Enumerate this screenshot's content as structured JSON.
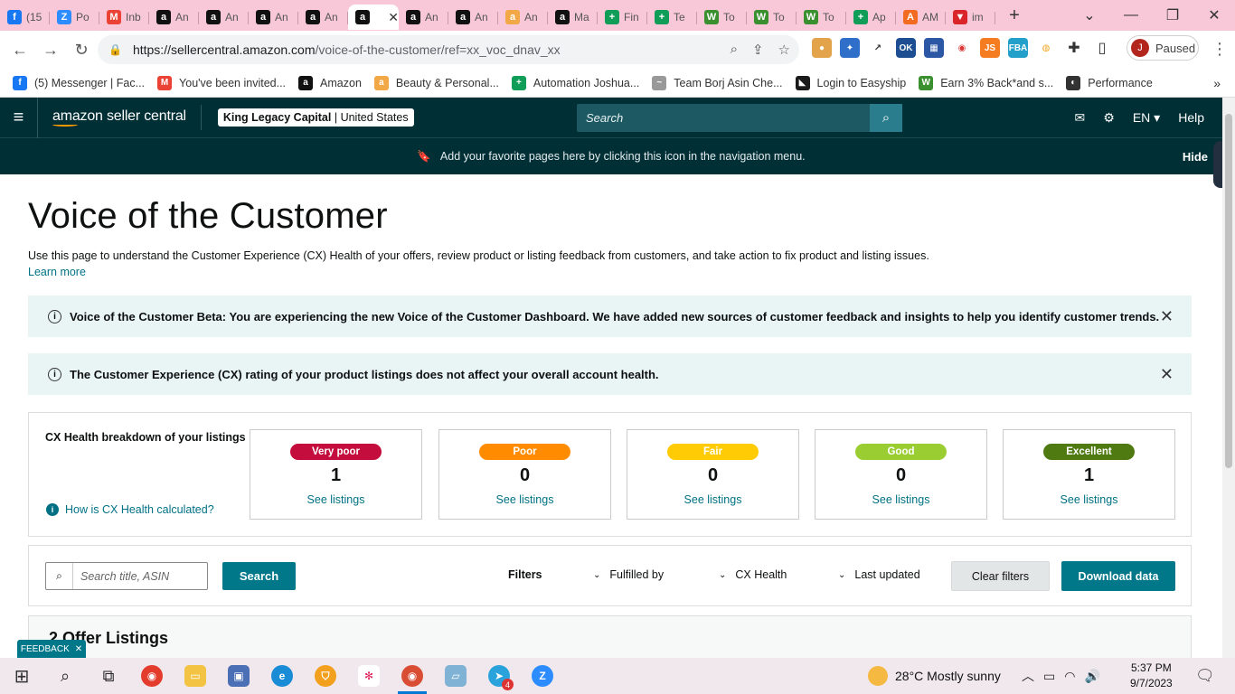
{
  "browser": {
    "tabs": [
      {
        "label": "(15",
        "icon": "facebook-icon",
        "color": "#1877f2",
        "glyph": "f"
      },
      {
        "label": "Po",
        "icon": "zoom-icon",
        "color": "#2d8cff",
        "glyph": "Z"
      },
      {
        "label": "Inb",
        "icon": "gmail-icon",
        "color": "#ea4335",
        "glyph": "M"
      },
      {
        "label": "An",
        "icon": "amazon-icon",
        "color": "#111",
        "glyph": "a"
      },
      {
        "label": "An",
        "icon": "amazon-icon",
        "color": "#111",
        "glyph": "a"
      },
      {
        "label": "An",
        "icon": "amazon-icon",
        "color": "#111",
        "glyph": "a"
      },
      {
        "label": "An",
        "icon": "amazon-icon",
        "color": "#111",
        "glyph": "a"
      },
      {
        "label": "",
        "icon": "amazon-icon",
        "color": "#111",
        "glyph": "a",
        "active": true
      },
      {
        "label": "An",
        "icon": "amazon-icon",
        "color": "#111",
        "glyph": "a"
      },
      {
        "label": "An",
        "icon": "amazon-icon",
        "color": "#111",
        "glyph": "a"
      },
      {
        "label": "An",
        "icon": "amazon-smile-icon",
        "color": "#f3a847",
        "glyph": "a"
      },
      {
        "label": "Ma",
        "icon": "amazon-icon",
        "color": "#111",
        "glyph": "a"
      },
      {
        "label": "Fin",
        "icon": "sheets-icon",
        "color": "#0f9d58",
        "glyph": "+"
      },
      {
        "label": "Te",
        "icon": "sheets-icon",
        "color": "#0f9d58",
        "glyph": "+"
      },
      {
        "label": "To",
        "icon": "wholesale-icon",
        "color": "#3a8f2e",
        "glyph": "W"
      },
      {
        "label": "To",
        "icon": "wholesale-icon",
        "color": "#3a8f2e",
        "glyph": "W"
      },
      {
        "label": "To",
        "icon": "wholesale-icon",
        "color": "#3a8f2e",
        "glyph": "W"
      },
      {
        "label": "Ap",
        "icon": "sheets-icon",
        "color": "#0f9d58",
        "glyph": "+"
      },
      {
        "label": "AM",
        "icon": "am-icon",
        "color": "#f26b21",
        "glyph": "A"
      },
      {
        "label": "im",
        "icon": "im-icon",
        "color": "#d9242a",
        "glyph": "▼"
      }
    ],
    "url_host": "https://sellercentral.amazon.com",
    "url_path": "/voice-of-the-customer/ref=xx_voc_dnav_xx",
    "profile_initial": "J",
    "profile_status": "Paused",
    "bookmarks": [
      {
        "label": "(5) Messenger | Fac...",
        "icon": "facebook-icon",
        "color": "#1877f2",
        "glyph": "f"
      },
      {
        "label": "You've been invited...",
        "icon": "gmail-icon",
        "color": "#ea4335",
        "glyph": "M"
      },
      {
        "label": "Amazon",
        "icon": "amazon-icon",
        "color": "#111",
        "glyph": "a"
      },
      {
        "label": "Beauty & Personal...",
        "icon": "amazon-smile-icon",
        "color": "#f3a847",
        "glyph": "a"
      },
      {
        "label": "Automation Joshua...",
        "icon": "sheets-icon",
        "color": "#0f9d58",
        "glyph": "+"
      },
      {
        "label": "Team Borj Asin Che...",
        "icon": "team-icon",
        "color": "#999",
        "glyph": "~"
      },
      {
        "label": "Login to Easyship",
        "icon": "easyship-icon",
        "color": "#1a1a1a",
        "glyph": "◣"
      },
      {
        "label": "Earn 3% Back*and s...",
        "icon": "wholesale-icon",
        "color": "#3a8f2e",
        "glyph": "W"
      },
      {
        "label": "Performance",
        "icon": "performance-icon",
        "color": "#333",
        "glyph": "◐"
      }
    ]
  },
  "header": {
    "logo_text": "amazon seller central",
    "account_name": "King Legacy Capital",
    "account_region": "United States",
    "search_placeholder": "Search",
    "lang": "EN",
    "help": "Help"
  },
  "favbar": {
    "message": "Add your favorite pages here by clicking this icon in the navigation menu.",
    "hide": "Hide"
  },
  "page": {
    "title": "Voice of the Customer",
    "description": "Use this page to understand the Customer Experience (CX) Health of your offers, review product or listing feedback from customers, and take action to fix product and listing issues.",
    "learn_more": "Learn more",
    "alerts": [
      "Voice of the Customer Beta: You are experiencing the new Voice of the Customer Dashboard. We have added new sources of customer feedback and insights to help you identify customer trends.",
      "The Customer Experience (CX) rating of your product listings does not affect your overall account health."
    ],
    "cx": {
      "title": "CX Health breakdown of your listings",
      "how": "How is CX Health calculated?",
      "cards": [
        {
          "label": "Very poor",
          "count": "1",
          "link": "See listings",
          "bg": "#c40c3d",
          "fg": "#ffffff"
        },
        {
          "label": "Poor",
          "count": "0",
          "link": "See listings",
          "bg": "#ff8c00",
          "fg": "#ffffff"
        },
        {
          "label": "Fair",
          "count": "0",
          "link": "See listings",
          "bg": "#ffcb05",
          "fg": "#ffffff"
        },
        {
          "label": "Good",
          "count": "0",
          "link": "See listings",
          "bg": "#9acd32",
          "fg": "#ffffff"
        },
        {
          "label": "Excellent",
          "count": "1",
          "link": "See listings",
          "bg": "#4f7a12",
          "fg": "#ffffff"
        }
      ]
    },
    "filters": {
      "search_placeholder": "Search title, ASIN",
      "search_button": "Search",
      "label": "Filters",
      "fulfilled_by": "Fulfilled by",
      "cx_health": "CX Health",
      "last_updated": "Last updated",
      "clear": "Clear filters",
      "download": "Download data"
    },
    "offers_title": "2 Offer Listings",
    "feedback": "FEEDBACK"
  },
  "taskbar": {
    "weather": "28°C  Mostly sunny",
    "time": "5:37 PM",
    "date": "9/7/2023",
    "telegram_badge": "4"
  }
}
